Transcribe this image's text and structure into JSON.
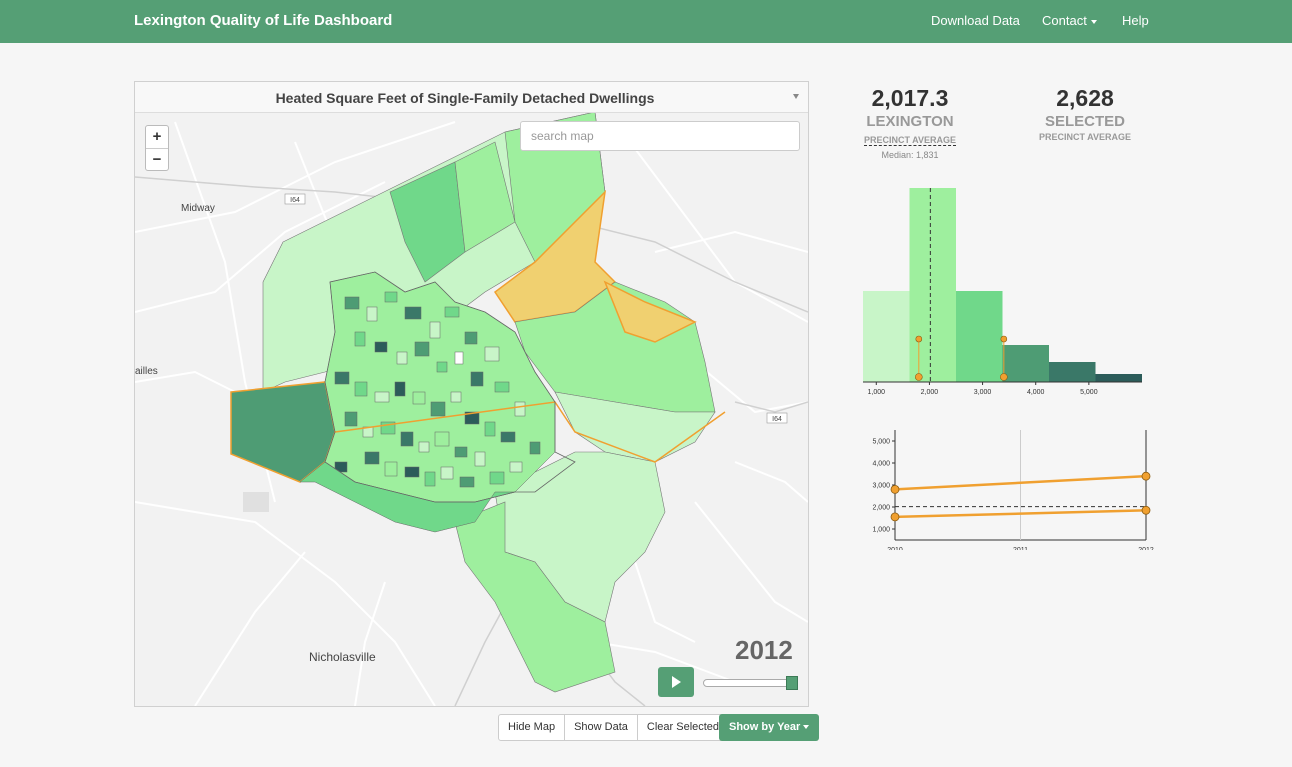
{
  "navbar": {
    "brand": "Lexington Quality of Life Dashboard",
    "download": "Download Data",
    "contact": "Contact",
    "help": "Help"
  },
  "map": {
    "title": "Heated Square Feet of Single-Family Detached Dwellings",
    "search_placeholder": "search map",
    "zoom_in": "+",
    "zoom_out": "−",
    "year": "2012",
    "places": [
      "Midway",
      "ailles",
      "Nicholasville"
    ],
    "shields": [
      "I64",
      "I64"
    ],
    "slider_fraction": 1.0
  },
  "buttons": {
    "hide_map": "Hide Map",
    "show_data": "Show Data",
    "clear_selected": "Clear Selected",
    "show_by_year": "Show by Year"
  },
  "stats": {
    "lexington": {
      "value": "2,017.3",
      "label": "LEXINGTON",
      "sub": "PRECINCT AVERAGE",
      "median": "Median: 1,831"
    },
    "selected": {
      "value": "2,628",
      "label": "SELECTED",
      "sub": "PRECINCT AVERAGE"
    }
  },
  "colors": {
    "brand_green": "#559f75",
    "selected_orange": "#f0a030",
    "bins": [
      "#c8f5c8",
      "#9eef9e",
      "#70d88a",
      "#4e9c74",
      "#3a7868",
      "#2c5c5a"
    ]
  },
  "chart_data": [
    {
      "type": "bar",
      "title": "",
      "x_ticks": [
        "1,000",
        "2,000",
        "3,000",
        "4,000",
        "5,000"
      ],
      "bin_edges": [
        750,
        1625,
        2500,
        3375,
        4250,
        5125,
        6000
      ],
      "values": [
        91,
        194,
        91,
        37,
        20,
        8
      ],
      "mean": 2017.3,
      "selected_markers": [
        {
          "x": 1800,
          "y": 43
        },
        {
          "x": 1800,
          "y": 5
        },
        {
          "x": 3400,
          "y": 43
        },
        {
          "x": 3400,
          "y": 5
        }
      ]
    },
    {
      "type": "line",
      "title": "",
      "x": [
        2010,
        2011,
        2012
      ],
      "x_ticks": [
        "2010",
        "2011",
        "2012"
      ],
      "y_ticks": [
        "1,000",
        "2,000",
        "3,000",
        "4,000",
        "5,000"
      ],
      "ylim": [
        500,
        5500
      ],
      "average_line": 2017.3,
      "series": [
        {
          "points": [
            [
              2010,
              2800
            ],
            [
              2012,
              3400
            ]
          ]
        },
        {
          "points": [
            [
              2010,
              1550
            ],
            [
              2012,
              1850
            ]
          ]
        }
      ]
    }
  ]
}
